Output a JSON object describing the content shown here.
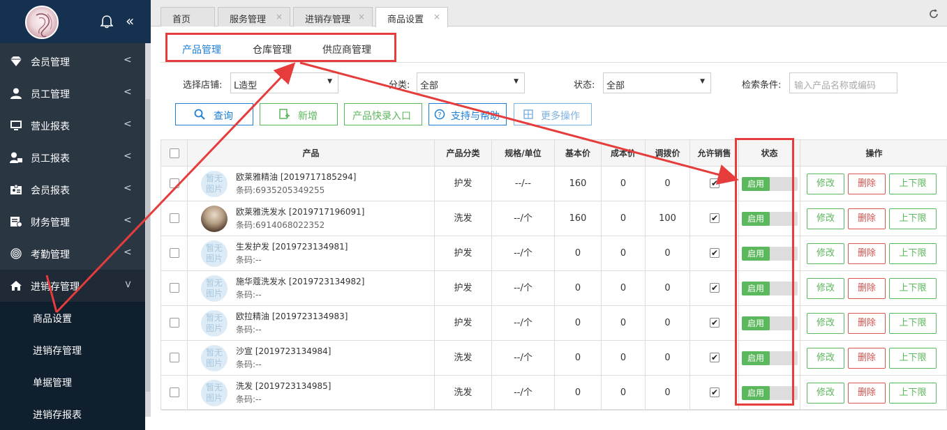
{
  "sidebar": {
    "items": [
      {
        "label": "会员管理",
        "icon": "diamond-icon"
      },
      {
        "label": "员工管理",
        "icon": "user-icon"
      },
      {
        "label": "营业报表",
        "icon": "monitor-icon"
      },
      {
        "label": "员工报表",
        "icon": "user-lock-icon"
      },
      {
        "label": "会员报表",
        "icon": "id-card-icon"
      },
      {
        "label": "财务管理",
        "icon": "finance-icon"
      },
      {
        "label": "考勤管理",
        "icon": "fingerprint-icon"
      },
      {
        "label": "进销存管理",
        "icon": "home-icon"
      }
    ],
    "sub_items": [
      "商品设置",
      "进销存管理",
      "单据管理",
      "进销存报表"
    ],
    "collapse_label": "«"
  },
  "tabs": [
    {
      "label": "首页",
      "close": ""
    },
    {
      "label": "服务管理",
      "close": "×"
    },
    {
      "label": "进销存管理",
      "close": "×"
    },
    {
      "label": "商品设置",
      "close": "×"
    }
  ],
  "sub_tabs": [
    "产品管理",
    "仓库管理",
    "供应商管理"
  ],
  "filters": {
    "store_label": "选择店铺:",
    "store_value": "L造型",
    "category_label": "分类:",
    "category_value": "全部",
    "status_label": "状态:",
    "status_value": "全部",
    "search_label": "检索条件:",
    "search_placeholder": "输入产品名称或编码"
  },
  "buttons": {
    "query": "查询",
    "add": "新增",
    "quick_entry": "产品快录入口",
    "help": "支持与帮助",
    "more": "更多操作"
  },
  "table": {
    "headers": [
      "产品",
      "产品分类",
      "规格/单位",
      "基本价",
      "成本价",
      "调拨价",
      "允许销售",
      "状态",
      "操作"
    ],
    "no_image_text": [
      "暂无",
      "图片"
    ],
    "status_on": "启用",
    "actions": [
      "修改",
      "删除",
      "上下限"
    ],
    "rows": [
      {
        "name": "欧莱雅精油 [2019717185294]",
        "code": "条码:6935205349255",
        "category": "护发",
        "spec": "--/--",
        "base": "160",
        "cost": "0",
        "transfer": "0",
        "photo": false
      },
      {
        "name": "欧莱雅洗发水 [2019717196091]",
        "code": "条码:6914068022352",
        "category": "洗发",
        "spec": "--/个",
        "base": "160",
        "cost": "0",
        "transfer": "100",
        "photo": true
      },
      {
        "name": "生发护发 [2019723134981]",
        "code": "条码:--",
        "category": "护发",
        "spec": "--/个",
        "base": "0",
        "cost": "0",
        "transfer": "0",
        "photo": false
      },
      {
        "name": "施华蔻洗发水 [2019723134982]",
        "code": "条码:--",
        "category": "护发",
        "spec": "--/个",
        "base": "0",
        "cost": "0",
        "transfer": "0",
        "photo": false
      },
      {
        "name": "欧拉精油 [2019723134983]",
        "code": "条码:--",
        "category": "护发",
        "spec": "--/个",
        "base": "0",
        "cost": "0",
        "transfer": "0",
        "photo": false
      },
      {
        "name": "沙宣 [2019723134984]",
        "code": "条码:--",
        "category": "洗发",
        "spec": "--/个",
        "base": "0",
        "cost": "0",
        "transfer": "0",
        "photo": false
      },
      {
        "name": "洗发 [2019723134985]",
        "code": "条码:--",
        "category": "洗发",
        "spec": "--/个",
        "base": "0",
        "cost": "0",
        "transfer": "0",
        "photo": false
      }
    ]
  },
  "colors": {
    "accent": "#1c7fd6",
    "sidebar_bg": "#2b3643",
    "sidebar_top": "#15314f",
    "annotation": "#e63c3c",
    "status_green": "#5cb85c",
    "edit_green": "#5cb85c",
    "delete_red": "#d9534f"
  }
}
